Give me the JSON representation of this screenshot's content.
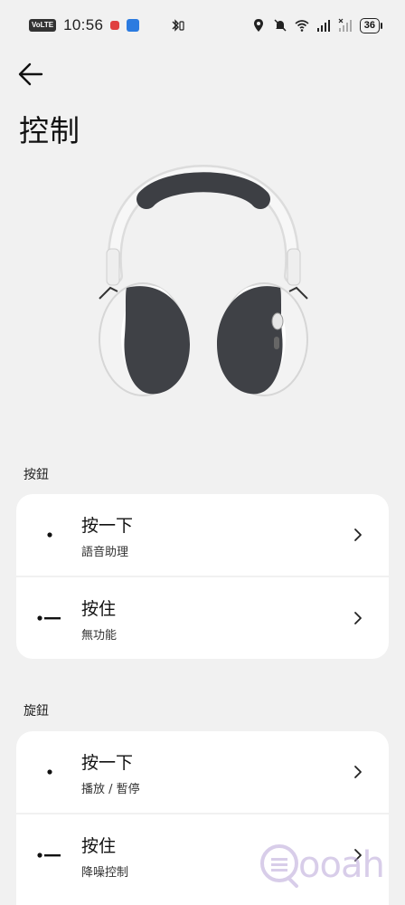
{
  "status": {
    "volte": "VoLTE",
    "time": "10:56",
    "battery": "36"
  },
  "header": {
    "title": "控制"
  },
  "sections": [
    {
      "label": "按鈕",
      "rows": [
        {
          "title": "按一下",
          "subtitle": "語音助理",
          "icon": "single-dot-icon"
        },
        {
          "title": "按住",
          "subtitle": "無功能",
          "icon": "dot-dash-icon"
        }
      ]
    },
    {
      "label": "旋鈕",
      "rows": [
        {
          "title": "按一下",
          "subtitle": "播放 / 暫停",
          "icon": "single-dot-icon"
        },
        {
          "title": "按住",
          "subtitle": "降噪控制",
          "icon": "dot-dash-icon"
        }
      ]
    }
  ],
  "watermark": "ooah",
  "colors": {
    "background": "#f1f1f1",
    "card": "#ffffff",
    "watermark": "#b9a5d8"
  }
}
